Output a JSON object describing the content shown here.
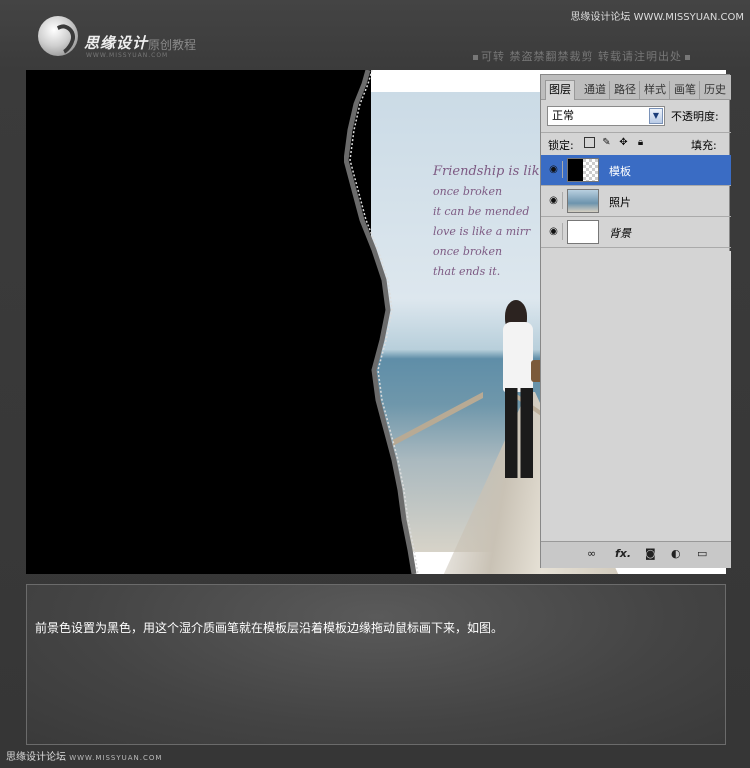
{
  "header": {
    "logo_name": "思缘设计",
    "logo_sub": "原创教程",
    "logo_url": "WWW.MISSYUAN.COM",
    "watermark": "思缘设计论坛 WWW.MISSYUAN.COM",
    "notice": "可转   禁盗禁翻禁裁剪   转载请注明出处"
  },
  "photo": {
    "poem": [
      "Friendship is like",
      "once broken",
      "it can be mended",
      "love is like a mirr",
      "once broken",
      "that ends it."
    ]
  },
  "layers_panel": {
    "tabs": [
      "图层",
      "通道",
      "路径",
      "样式",
      "画笔",
      "历史"
    ],
    "blend_mode": "正常",
    "opacity_label": "不透明度:",
    "lock_label": "锁定:",
    "fill_label": "填充:",
    "layers": [
      {
        "name": "模板",
        "selected": true
      },
      {
        "name": "照片",
        "selected": false
      },
      {
        "name": "背景",
        "selected": false
      }
    ],
    "selection_color": "#3a6cc4"
  },
  "caption": "前景色设置为黑色，用这个湿介质画笔就在模板层沿着模板边缘拖动鼠标画下来，如图。",
  "footer": {
    "watermark": "思缘设计论坛",
    "url": "WWW.MISSYUAN.COM"
  }
}
